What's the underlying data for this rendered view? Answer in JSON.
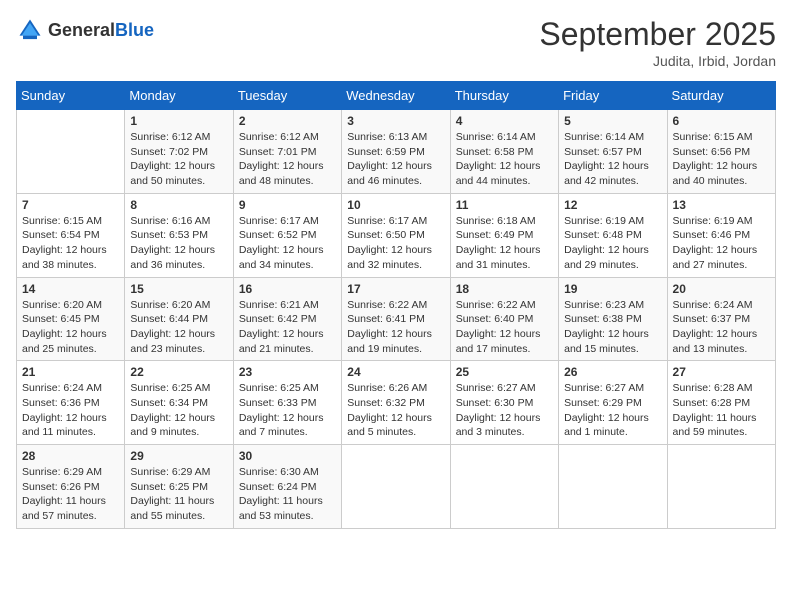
{
  "logo": {
    "general": "General",
    "blue": "Blue"
  },
  "title": "September 2025",
  "location": "Judita, Irbid, Jordan",
  "days_header": [
    "Sunday",
    "Monday",
    "Tuesday",
    "Wednesday",
    "Thursday",
    "Friday",
    "Saturday"
  ],
  "weeks": [
    [
      {
        "day": "",
        "info": ""
      },
      {
        "day": "1",
        "info": "Sunrise: 6:12 AM\nSunset: 7:02 PM\nDaylight: 12 hours\nand 50 minutes."
      },
      {
        "day": "2",
        "info": "Sunrise: 6:12 AM\nSunset: 7:01 PM\nDaylight: 12 hours\nand 48 minutes."
      },
      {
        "day": "3",
        "info": "Sunrise: 6:13 AM\nSunset: 6:59 PM\nDaylight: 12 hours\nand 46 minutes."
      },
      {
        "day": "4",
        "info": "Sunrise: 6:14 AM\nSunset: 6:58 PM\nDaylight: 12 hours\nand 44 minutes."
      },
      {
        "day": "5",
        "info": "Sunrise: 6:14 AM\nSunset: 6:57 PM\nDaylight: 12 hours\nand 42 minutes."
      },
      {
        "day": "6",
        "info": "Sunrise: 6:15 AM\nSunset: 6:56 PM\nDaylight: 12 hours\nand 40 minutes."
      }
    ],
    [
      {
        "day": "7",
        "info": "Sunrise: 6:15 AM\nSunset: 6:54 PM\nDaylight: 12 hours\nand 38 minutes."
      },
      {
        "day": "8",
        "info": "Sunrise: 6:16 AM\nSunset: 6:53 PM\nDaylight: 12 hours\nand 36 minutes."
      },
      {
        "day": "9",
        "info": "Sunrise: 6:17 AM\nSunset: 6:52 PM\nDaylight: 12 hours\nand 34 minutes."
      },
      {
        "day": "10",
        "info": "Sunrise: 6:17 AM\nSunset: 6:50 PM\nDaylight: 12 hours\nand 32 minutes."
      },
      {
        "day": "11",
        "info": "Sunrise: 6:18 AM\nSunset: 6:49 PM\nDaylight: 12 hours\nand 31 minutes."
      },
      {
        "day": "12",
        "info": "Sunrise: 6:19 AM\nSunset: 6:48 PM\nDaylight: 12 hours\nand 29 minutes."
      },
      {
        "day": "13",
        "info": "Sunrise: 6:19 AM\nSunset: 6:46 PM\nDaylight: 12 hours\nand 27 minutes."
      }
    ],
    [
      {
        "day": "14",
        "info": "Sunrise: 6:20 AM\nSunset: 6:45 PM\nDaylight: 12 hours\nand 25 minutes."
      },
      {
        "day": "15",
        "info": "Sunrise: 6:20 AM\nSunset: 6:44 PM\nDaylight: 12 hours\nand 23 minutes."
      },
      {
        "day": "16",
        "info": "Sunrise: 6:21 AM\nSunset: 6:42 PM\nDaylight: 12 hours\nand 21 minutes."
      },
      {
        "day": "17",
        "info": "Sunrise: 6:22 AM\nSunset: 6:41 PM\nDaylight: 12 hours\nand 19 minutes."
      },
      {
        "day": "18",
        "info": "Sunrise: 6:22 AM\nSunset: 6:40 PM\nDaylight: 12 hours\nand 17 minutes."
      },
      {
        "day": "19",
        "info": "Sunrise: 6:23 AM\nSunset: 6:38 PM\nDaylight: 12 hours\nand 15 minutes."
      },
      {
        "day": "20",
        "info": "Sunrise: 6:24 AM\nSunset: 6:37 PM\nDaylight: 12 hours\nand 13 minutes."
      }
    ],
    [
      {
        "day": "21",
        "info": "Sunrise: 6:24 AM\nSunset: 6:36 PM\nDaylight: 12 hours\nand 11 minutes."
      },
      {
        "day": "22",
        "info": "Sunrise: 6:25 AM\nSunset: 6:34 PM\nDaylight: 12 hours\nand 9 minutes."
      },
      {
        "day": "23",
        "info": "Sunrise: 6:25 AM\nSunset: 6:33 PM\nDaylight: 12 hours\nand 7 minutes."
      },
      {
        "day": "24",
        "info": "Sunrise: 6:26 AM\nSunset: 6:32 PM\nDaylight: 12 hours\nand 5 minutes."
      },
      {
        "day": "25",
        "info": "Sunrise: 6:27 AM\nSunset: 6:30 PM\nDaylight: 12 hours\nand 3 minutes."
      },
      {
        "day": "26",
        "info": "Sunrise: 6:27 AM\nSunset: 6:29 PM\nDaylight: 12 hours\nand 1 minute."
      },
      {
        "day": "27",
        "info": "Sunrise: 6:28 AM\nSunset: 6:28 PM\nDaylight: 11 hours\nand 59 minutes."
      }
    ],
    [
      {
        "day": "28",
        "info": "Sunrise: 6:29 AM\nSunset: 6:26 PM\nDaylight: 11 hours\nand 57 minutes."
      },
      {
        "day": "29",
        "info": "Sunrise: 6:29 AM\nSunset: 6:25 PM\nDaylight: 11 hours\nand 55 minutes."
      },
      {
        "day": "30",
        "info": "Sunrise: 6:30 AM\nSunset: 6:24 PM\nDaylight: 11 hours\nand 53 minutes."
      },
      {
        "day": "",
        "info": ""
      },
      {
        "day": "",
        "info": ""
      },
      {
        "day": "",
        "info": ""
      },
      {
        "day": "",
        "info": ""
      }
    ]
  ]
}
